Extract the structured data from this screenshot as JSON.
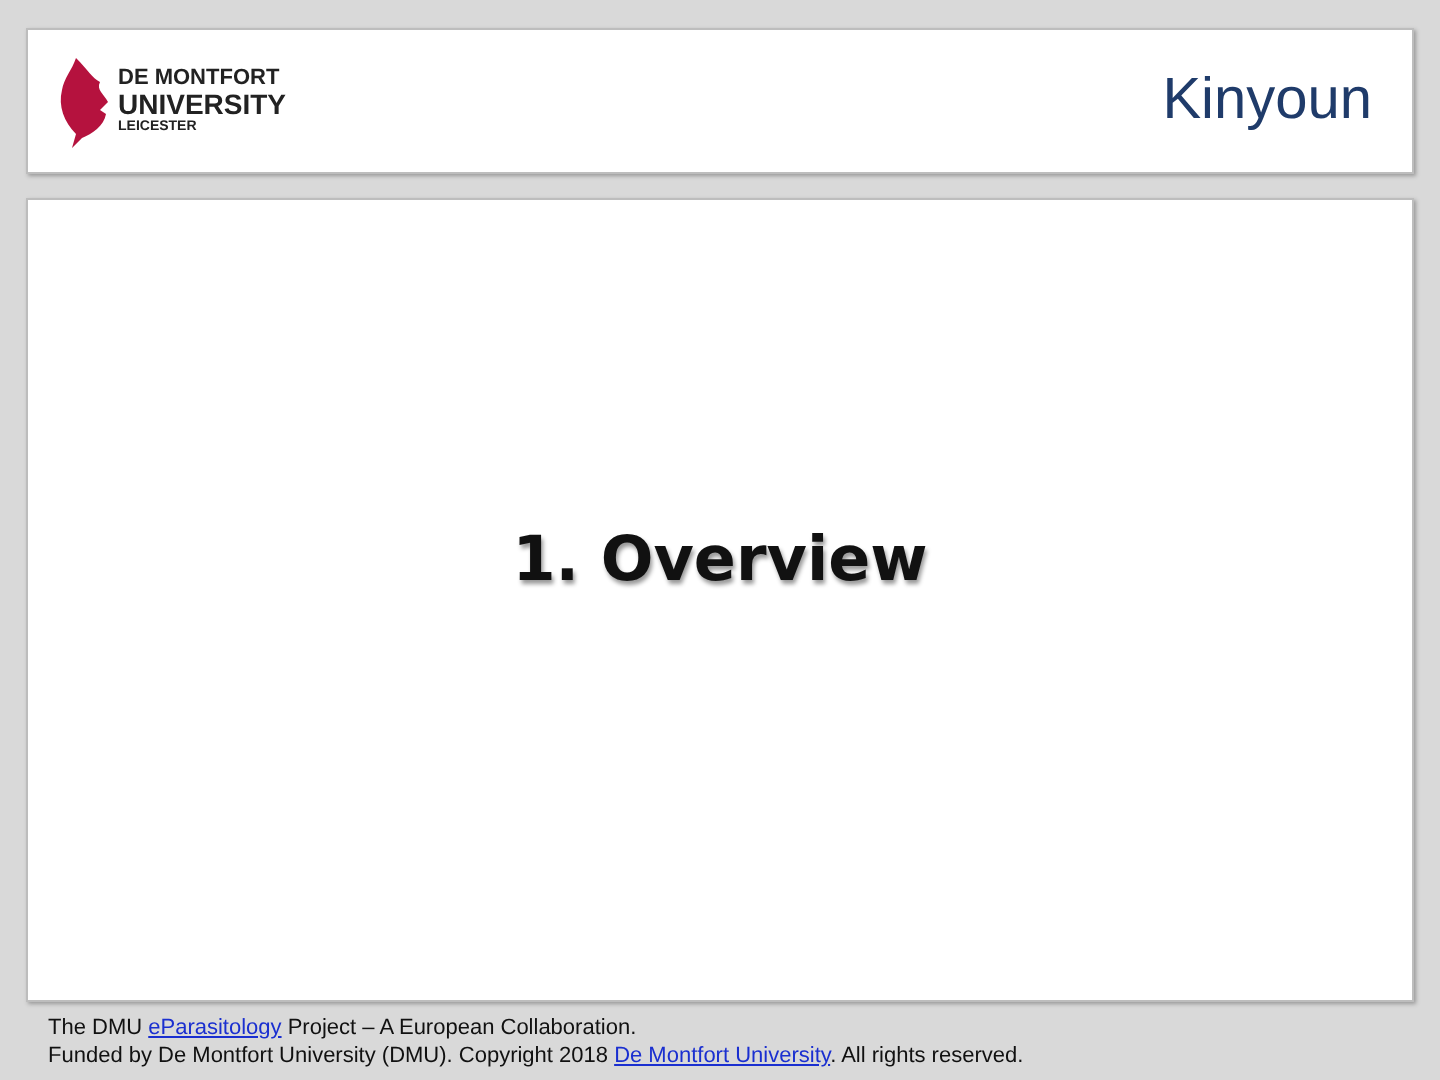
{
  "header": {
    "logo": {
      "lines": [
        "DE MONTFORT",
        "UNIVERSITY",
        "LEICESTER"
      ]
    },
    "title": "Kinyoun"
  },
  "slide": {
    "heading": "1. Overview"
  },
  "footer": {
    "lines": [
      {
        "parts": [
          {
            "text": "The DMU ",
            "link": false
          },
          {
            "text": "eParasitology",
            "link": true
          },
          {
            "text": " Project – A European Collaboration.",
            "link": false
          }
        ]
      },
      {
        "parts": [
          {
            "text": "Funded by De Montfort University (DMU). Copyright 2018 ",
            "link": false
          },
          {
            "text": "De Montfort University",
            "link": true
          },
          {
            "text": ". All rights reserved.",
            "link": false
          }
        ]
      }
    ]
  }
}
